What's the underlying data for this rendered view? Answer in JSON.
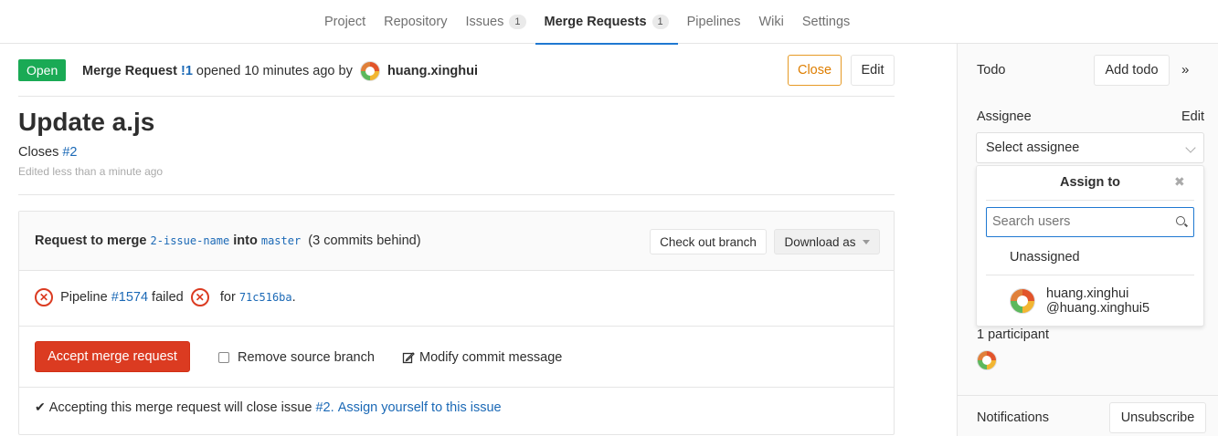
{
  "topnav": {
    "items": [
      {
        "label": "Project"
      },
      {
        "label": "Repository"
      },
      {
        "label": "Issues",
        "count": "1"
      },
      {
        "label": "Merge Requests",
        "count": "1",
        "active": true
      },
      {
        "label": "Pipelines"
      },
      {
        "label": "Wiki"
      },
      {
        "label": "Settings"
      }
    ]
  },
  "mr": {
    "status": "Open",
    "prefix": "Merge Request",
    "ref": "!1",
    "opened_text": "opened 10 minutes ago by",
    "author": "huang.xinghui",
    "close_label": "Close",
    "edit_label": "Edit",
    "title": "Update a.js",
    "closes_prefix": "Closes",
    "closes_ref": "#2",
    "edited": "Edited less than a minute ago"
  },
  "widget": {
    "request_label": "Request to merge",
    "source_branch": "2-issue-name",
    "into_label": "into",
    "target_branch": "master",
    "behind": "(3 commits behind)",
    "checkout_label": "Check out branch",
    "download_label": "Download as",
    "pipeline_label": "Pipeline",
    "pipeline_ref": "#1574",
    "pipeline_status": "failed",
    "for_label": "for",
    "commit": "71c516ba",
    "accept_label": "Accept merge request",
    "remove_source_label": "Remove source branch",
    "modify_label": "Modify commit message",
    "footer_text": "Accepting this merge request will close issue",
    "footer_issue": "#2.",
    "footer_link": "Assign yourself to this issue"
  },
  "sidebar": {
    "todo_label": "Todo",
    "add_todo_label": "Add todo",
    "collapse_glyph": "»",
    "assignee_label": "Assignee",
    "assignee_edit": "Edit",
    "select_placeholder": "Select assignee",
    "dropdown": {
      "title": "Assign to",
      "close_glyph": "✖",
      "search_placeholder": "Search users",
      "unassigned": "Unassigned",
      "user_name": "huang.xinghui",
      "user_handle": "@huang.xinghui5"
    },
    "participants_label": "1 participant",
    "notifications_label": "Notifications",
    "unsubscribe_label": "Unsubscribe"
  },
  "colors": {
    "open_green": "#1aaa55",
    "accept_red": "#db3b21",
    "close_orange": "#de7e00",
    "link_blue": "#1b69b6"
  },
  "icons": [
    "avatar",
    "fail-icon",
    "checkbox",
    "edit-icon",
    "check-icon",
    "search-icon",
    "close-icon",
    "chevron-down-icon",
    "collapse-icon"
  ]
}
